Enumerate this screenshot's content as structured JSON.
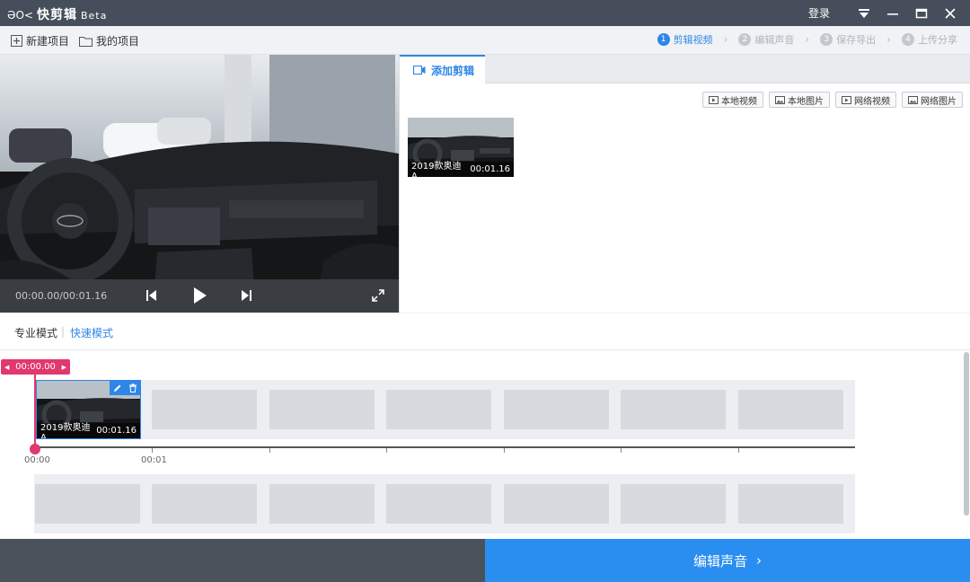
{
  "app": {
    "logo_icon": "ƏO<",
    "name": "快剪辑",
    "badge": "Beta",
    "login": "登录"
  },
  "toolbar": {
    "new_project": "新建项目",
    "my_projects": "我的项目"
  },
  "steps": [
    {
      "num": "1",
      "label": "剪辑视频",
      "active": true
    },
    {
      "num": "2",
      "label": "编辑声音",
      "active": false
    },
    {
      "num": "3",
      "label": "保存导出",
      "active": false
    },
    {
      "num": "4",
      "label": "上传分享",
      "active": false
    }
  ],
  "preview": {
    "timecode": "00:00.00/00:01.16"
  },
  "panel": {
    "tab": "添加剪辑",
    "sources": [
      "本地视频",
      "本地图片",
      "网络视频",
      "网络图片"
    ],
    "media": {
      "title": "2019款奥迪A...",
      "duration": "00:01.16"
    }
  },
  "modes": {
    "pro": "专业模式",
    "quick": "快速模式",
    "active": "quick"
  },
  "timeline": {
    "playhead": "00:00.00",
    "clip": {
      "title": "2019款奥迪A...",
      "duration": "00:01.16"
    },
    "ruler": [
      "00:00",
      "00:01"
    ]
  },
  "footer": {
    "next": "编辑声音"
  },
  "colors": {
    "accent": "#2e86e6",
    "playhead": "#e1386d",
    "titlebar": "#454e5a",
    "cta": "#2a8ef0"
  }
}
